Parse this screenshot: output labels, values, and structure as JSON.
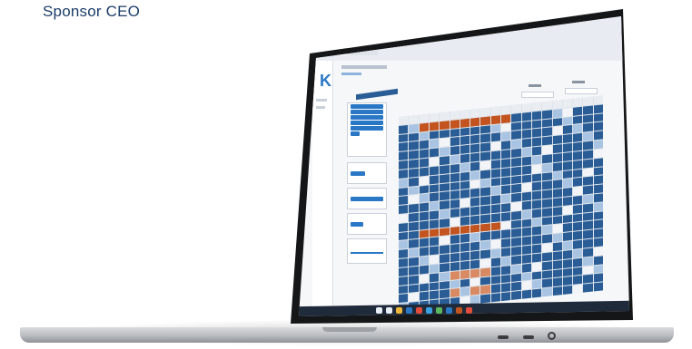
{
  "caption": "Sponsor CEO",
  "colors": {
    "heat_blue": "#2a5d95",
    "heat_light": "#a9c4e2",
    "heat_white": "#f2f4f7",
    "heat_orange": "#c4541f",
    "accent": "#2a78c5"
  },
  "icons": {
    "logo": "K",
    "taskbar": [
      "windows-icon",
      "search-icon",
      "files-icon",
      "browser-icon",
      "settings-icon",
      "mail-icon",
      "app-icon",
      "app-icon",
      "app-icon",
      "app-icon"
    ]
  }
}
